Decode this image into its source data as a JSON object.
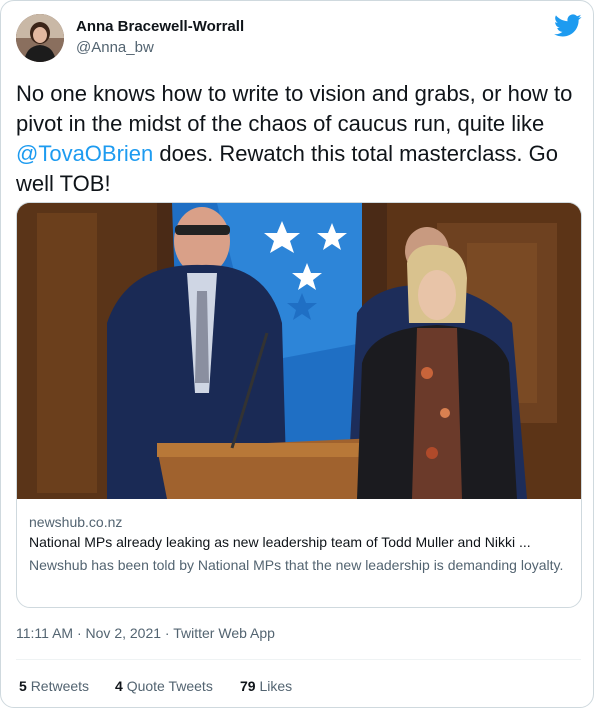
{
  "author": {
    "name": "Anna Bracewell-Worrall",
    "handle": "@Anna_bw"
  },
  "tweet": {
    "text_before": "No one knows how to write to vision and grabs, or how to pivot in the midst of the chaos of caucus run, quite like ",
    "mention": "@TovaOBrien",
    "text_after": " does. Rewatch this total masterclass. Go well TOB!"
  },
  "card": {
    "domain": "newshub.co.nz",
    "title": "National MPs already leaking as new leadership team of Todd Muller and Nikki ...",
    "description": "Newshub has been told by National MPs that the new leadership is demanding loyalty."
  },
  "meta": {
    "time": "11:11 AM",
    "date": "Nov 2, 2021",
    "source": "Twitter Web App",
    "separator": "·"
  },
  "stats": {
    "retweets_count": "5",
    "retweets_label": "Retweets",
    "quotes_count": "4",
    "quotes_label": "Quote Tweets",
    "likes_count": "79",
    "likes_label": "Likes"
  },
  "colors": {
    "accent": "#1d9bf0",
    "text": "#0f1419",
    "secondary": "#536471",
    "border": "#cfd9de"
  },
  "icons": {
    "brand": "twitter-bird-icon"
  }
}
